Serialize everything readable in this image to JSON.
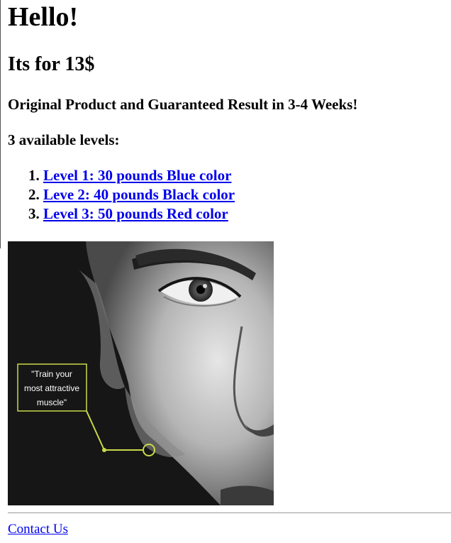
{
  "header": {
    "greeting": "Hello!",
    "price": "Its for 13$"
  },
  "promo": {
    "guarantee": "Original Product and Guaranteed Result in 3-4 Weeks!",
    "levels_heading": "3 available levels:"
  },
  "levels": [
    {
      "label": "Level 1: 30 pounds Blue color"
    },
    {
      "label": "Leve 2: 40 pounds Black color"
    },
    {
      "label": "Level 3: 50 pounds Red color"
    }
  ],
  "image": {
    "callout_line1": "\"Train your",
    "callout_line2": "most attractive",
    "callout_line3": "muscle\""
  },
  "footer": {
    "contact_label": "Contact Us"
  },
  "colors": {
    "link": "#0000ee",
    "callout": "#c9d84a"
  }
}
